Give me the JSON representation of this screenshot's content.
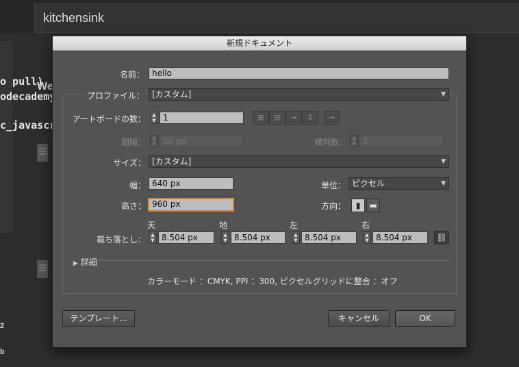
{
  "background": {
    "search_text": "kitchensink",
    "code_lines": [
      "o pull)",
      "odecademy",
      "c_javascr"
    ],
    "frag_we": "We",
    "frag_2": "2",
    "frag_b": "b"
  },
  "dialog": {
    "title": "新規ドキュメント",
    "name": {
      "label": "名前：",
      "value": "hello"
    },
    "profile": {
      "label": "プロファイル：",
      "value": "[カスタム]"
    },
    "artboards": {
      "label": "アートボードの数：",
      "value": "1"
    },
    "spacing": {
      "label": "間隔：",
      "value": "20 px"
    },
    "columns": {
      "label": "横列数：",
      "value": "1"
    },
    "size": {
      "label": "サイズ：",
      "value": "[カスタム]"
    },
    "width": {
      "label": "幅：",
      "value": "640 px"
    },
    "units": {
      "label": "単位：",
      "value": "ピクセル"
    },
    "height": {
      "label": "高さ：",
      "value": "960 px"
    },
    "orientation": {
      "label": "方向："
    },
    "bleed": {
      "label": "裁ち落とし：",
      "top": {
        "label": "天",
        "value": "8.504 px"
      },
      "bottom": {
        "label": "地",
        "value": "8.504 px"
      },
      "left": {
        "label": "左",
        "value": "8.504 px"
      },
      "right": {
        "label": "右",
        "value": "8.504 px"
      }
    },
    "advanced": {
      "label": "詳細"
    },
    "status_line": "カラーモード ：CMYK, PPI ：300, ピクセルグリッドに整合 ：オフ",
    "templates_button": "テンプレート...",
    "cancel_button": "キャンセル",
    "ok_button": "OK"
  }
}
